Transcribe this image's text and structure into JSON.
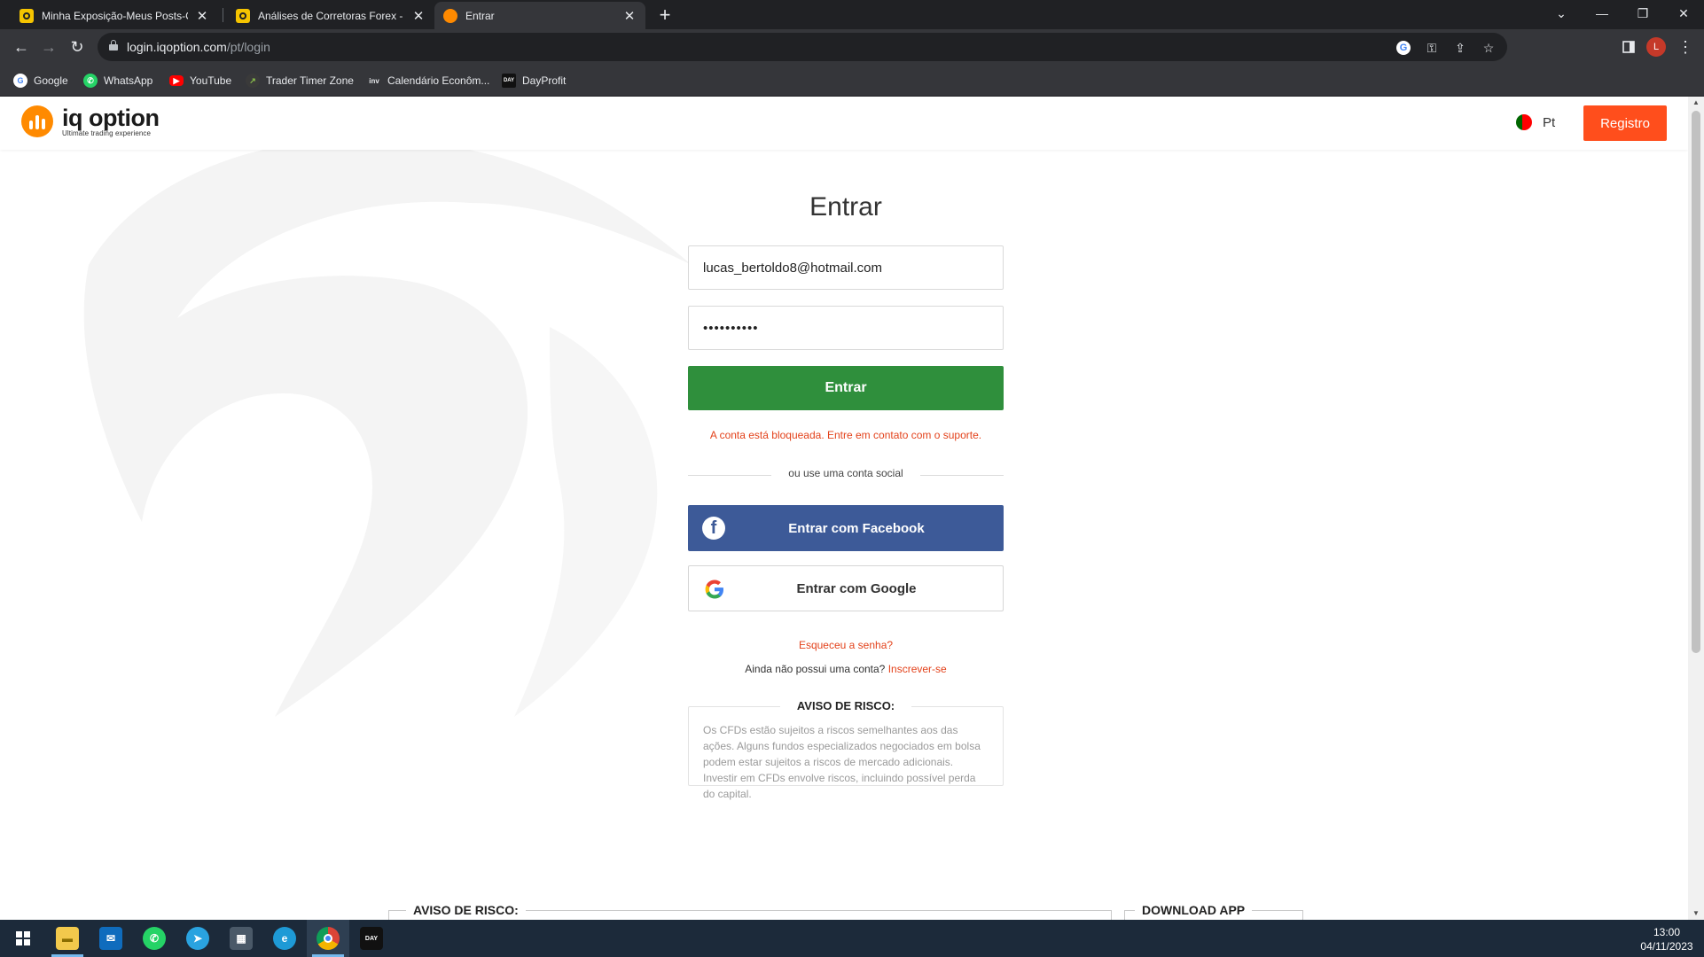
{
  "browser": {
    "tabs": [
      {
        "title": "Minha Exposição-Meus Posts-Co",
        "active": false
      },
      {
        "title": "Análises de Corretoras Forex - Pi",
        "active": false
      },
      {
        "title": "Entrar",
        "active": true
      }
    ],
    "new_tab_label": "+",
    "window_controls": {
      "tab_search": "⌄",
      "minimize": "—",
      "restore": "❐",
      "close": "✕"
    },
    "nav": {
      "back": "←",
      "forward": "→",
      "reload": "↻"
    },
    "address": {
      "host": "login.iqoption.com",
      "path": "/pt/login"
    },
    "omnibox_icons": {
      "google": "G",
      "key": "⚿",
      "share": "⇪",
      "star": "☆"
    },
    "profile_initial": "L",
    "menu": "⋮",
    "bookmarks": [
      {
        "label": "Google",
        "icon": "google-icon"
      },
      {
        "label": "WhatsApp",
        "icon": "whatsapp-icon"
      },
      {
        "label": "YouTube",
        "icon": "youtube-icon"
      },
      {
        "label": "Trader Timer Zone",
        "icon": "chart-icon"
      },
      {
        "label": "Calendário Econôm...",
        "icon": "investing-icon"
      },
      {
        "label": "DayProfit",
        "icon": "dayprofit-icon"
      }
    ]
  },
  "site": {
    "logo": {
      "name": "iq option",
      "tagline": "Ultimate trading experience"
    },
    "language": "Pt",
    "register_label": "Registro"
  },
  "login": {
    "title": "Entrar",
    "email_value": "lucas_bertoldo8@hotmail.com",
    "password_value": "••••••••••",
    "submit_label": "Entrar",
    "error": "A conta está bloqueada. Entre em contato com o suporte.",
    "divider": "ou use uma conta social",
    "facebook_label": "Entrar com Facebook",
    "google_label": "Entrar com Google",
    "forgot_label": "Esqueceu a senha?",
    "signup_prompt": "Ainda não possui uma conta?",
    "signup_link": "Inscrever-se",
    "risk_title": "AVISO DE RISCO:",
    "risk_text": "Os CFDs estão sujeitos a riscos semelhantes aos das ações. Alguns fundos especializados negociados em bolsa podem estar sujeitos a riscos de mercado adicionais. Investir em CFDs envolve riscos, incluindo possível perda do capital."
  },
  "footer": {
    "risk_title": "AVISO DE RISCO:",
    "app_title": "DOWNLOAD APP"
  },
  "taskbar": {
    "time": "13:00",
    "date": "04/11/2023",
    "apps": [
      "start-icon",
      "file-explorer-icon",
      "mail-icon",
      "whatsapp-icon",
      "telegram-icon",
      "calculator-icon",
      "edge-icon",
      "chrome-icon",
      "dayprofit-icon"
    ]
  },
  "colors": {
    "brand_orange": "#ff8a00",
    "register_red": "#ff4e1c",
    "submit_green": "#2f8f3c",
    "facebook_blue": "#3d5a98",
    "error_red": "#e3421b"
  }
}
